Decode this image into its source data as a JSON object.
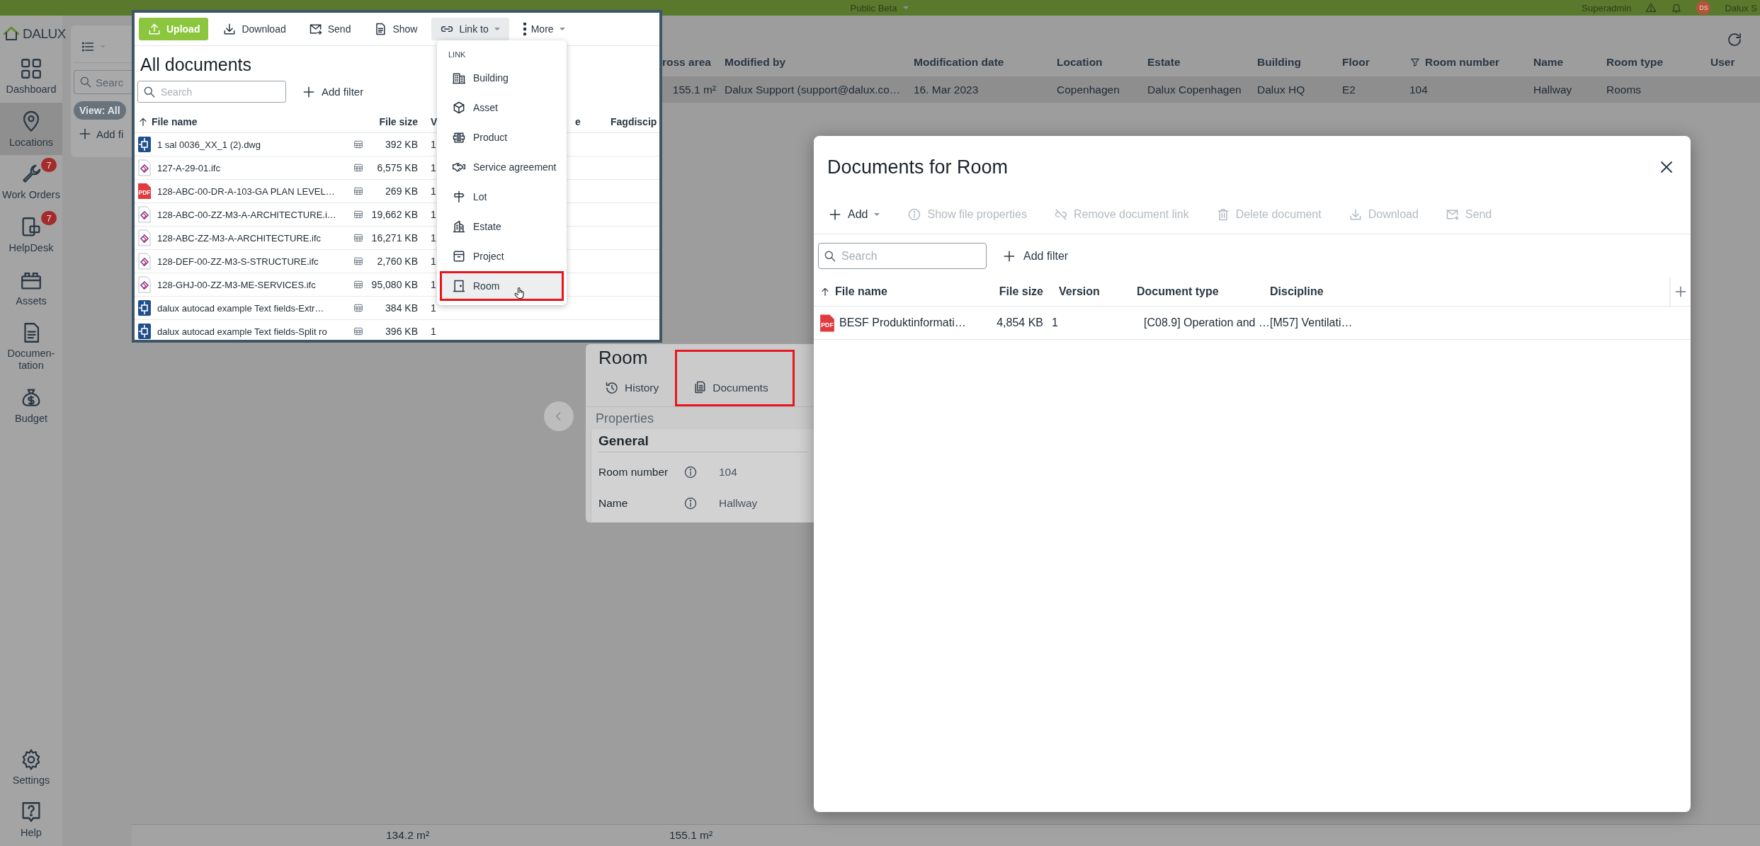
{
  "top_bar": {
    "project": "Public Beta",
    "role": "Superadmin",
    "avatar": "DS",
    "user": "Dalux S"
  },
  "sidebar": {
    "logo": "DALUX",
    "items": [
      {
        "label": "Dashboard",
        "selected": false
      },
      {
        "label": "Locations",
        "selected": true
      },
      {
        "label": "Work Orders",
        "selected": false,
        "badge": "7"
      },
      {
        "label": "HelpDesk",
        "selected": false,
        "badge": "7"
      },
      {
        "label": "Assets",
        "selected": false
      },
      {
        "label": "Documen-tation",
        "selected": false
      },
      {
        "label": "Budget",
        "selected": false
      }
    ],
    "bottom_items": [
      {
        "label": "Settings",
        "selected": false
      },
      {
        "label": "Help",
        "selected": false
      }
    ]
  },
  "back_panel": {
    "search_placeholder": "Searc",
    "view_chip": "View: All",
    "add_filter": "Add fi"
  },
  "back_table": {
    "columns": [
      {
        "label": "ross area",
        "filtered": false
      },
      {
        "label": "Modified by",
        "filtered": false
      },
      {
        "label": "Modification date",
        "filtered": false
      },
      {
        "label": "Location",
        "filtered": false
      },
      {
        "label": "Estate",
        "filtered": false
      },
      {
        "label": "Building",
        "filtered": false
      },
      {
        "label": "Floor",
        "filtered": false
      },
      {
        "label": "Room number",
        "filtered": true
      },
      {
        "label": "Name",
        "filtered": false
      },
      {
        "label": "Room type",
        "filtered": false
      },
      {
        "label": "User",
        "filtered": false
      }
    ],
    "rows": [
      {
        "selected": true,
        "cells": [
          "155.1 m²",
          "Dalux Support (support@dalux.co…",
          "16. Mar 2023",
          "Copenhagen",
          "Dalux Copenhagen",
          "Dalux HQ",
          "E2",
          "104",
          "Hallway",
          "Rooms",
          ""
        ]
      }
    ],
    "footer": [
      "134.2 m²",
      "155.1 m²"
    ]
  },
  "documents_window": {
    "toolbar": [
      {
        "label": "Upload",
        "kind": "primary",
        "expanded": false
      },
      {
        "label": "Download",
        "kind": "plain",
        "expanded": false
      },
      {
        "label": "Send",
        "kind": "plain",
        "expanded": false
      },
      {
        "label": "Show",
        "kind": "plain",
        "expanded": false
      },
      {
        "label": "Link to",
        "kind": "dropdown",
        "expanded": true
      },
      {
        "label": "More",
        "kind": "dropdown",
        "expanded": false
      }
    ],
    "title": "All documents",
    "search_placeholder": "Search",
    "add_filter": "Add filter",
    "columns": [
      {
        "label": "File name",
        "sorted": true
      },
      {
        "label": "File size",
        "sorted": false
      },
      {
        "label": "V",
        "sorted": false
      },
      {
        "label": "e",
        "sorted": false
      },
      {
        "label": "Fagdiscip",
        "sorted": false
      }
    ],
    "rows": [
      {
        "kind": "dwg",
        "name": "1 sal 0036_XX_1 (2).dwg",
        "size": "392 KB",
        "version": "1"
      },
      {
        "kind": "ifc",
        "name": "127-A-29-01.ifc",
        "size": "6,575 KB",
        "version": "1"
      },
      {
        "kind": "pdf",
        "badge": "PDF",
        "name": "128-ABC-00-DR-A-103-GA PLAN LEVEL…",
        "size": "269 KB",
        "version": "1"
      },
      {
        "kind": "ifc",
        "name": "128-ABC-00-ZZ-M3-A-ARCHITECTURE.i…",
        "size": "19,662 KB",
        "version": "1"
      },
      {
        "kind": "ifc",
        "name": "128-ABC-ZZ-M3-A-ARCHITECTURE.ifc",
        "size": "16,271 KB",
        "version": "1"
      },
      {
        "kind": "ifc",
        "name": "128-DEF-00-ZZ-M3-S-STRUCTURE.ifc",
        "size": "2,760 KB",
        "version": "1"
      },
      {
        "kind": "ifc",
        "name": "128-GHJ-00-ZZ-M3-ME-SERVICES.ifc",
        "size": "95,080 KB",
        "version": "1"
      },
      {
        "kind": "dwg",
        "name": "dalux autocad example Text fields-Extr…",
        "size": "384 KB",
        "version": "1"
      },
      {
        "kind": "dwg",
        "name": "dalux autocad example Text fields-Split ro",
        "size": "396 KB",
        "version": "1"
      }
    ],
    "link_menu": {
      "header": "LINK",
      "items": [
        {
          "label": "Building",
          "hovered": false,
          "annotated": false
        },
        {
          "label": "Asset",
          "hovered": false,
          "annotated": false
        },
        {
          "label": "Product",
          "hovered": false,
          "annotated": false
        },
        {
          "label": "Service agreement",
          "hovered": false,
          "annotated": false
        },
        {
          "label": "Lot",
          "hovered": false,
          "annotated": false
        },
        {
          "label": "Estate",
          "hovered": false,
          "annotated": false
        },
        {
          "label": "Project",
          "hovered": false,
          "annotated": false
        },
        {
          "label": "Room",
          "hovered": true,
          "annotated": true
        }
      ]
    }
  },
  "room_panel": {
    "title": "Room",
    "tabs": [
      {
        "label": "History",
        "annotated": false
      },
      {
        "label": "Documents",
        "annotated": true
      }
    ],
    "section": "Properties",
    "group": "General",
    "fields": [
      {
        "label": "Room number",
        "value": "104"
      },
      {
        "label": "Name",
        "value": "Hallway"
      }
    ]
  },
  "dialog": {
    "title": "Documents for Room",
    "toolbar": [
      {
        "label": "Add",
        "kind": "dropdown",
        "disabled": false
      },
      {
        "label": "Show file properties",
        "kind": "plain",
        "disabled": true
      },
      {
        "label": "Remove document link",
        "kind": "plain",
        "disabled": true
      },
      {
        "label": "Delete document",
        "kind": "plain",
        "disabled": true
      },
      {
        "label": "Download",
        "kind": "plain",
        "disabled": true
      },
      {
        "label": "Send",
        "kind": "plain",
        "disabled": true
      }
    ],
    "search_placeholder": "Search",
    "add_filter": "Add filter",
    "columns": [
      {
        "label": "File name",
        "sorted": true
      },
      {
        "label": "File size",
        "sorted": false
      },
      {
        "label": "Version",
        "sorted": false
      },
      {
        "label": "Document type",
        "sorted": false
      },
      {
        "label": "Discipline",
        "sorted": false
      }
    ],
    "rows": [
      {
        "kind": "pdf",
        "badge": "PDF",
        "cells": [
          "BESF Produktinformati…",
          "4,854 KB",
          "1",
          "[C08.9] Operation and …",
          "[M57] Ventilati…"
        ]
      }
    ]
  }
}
